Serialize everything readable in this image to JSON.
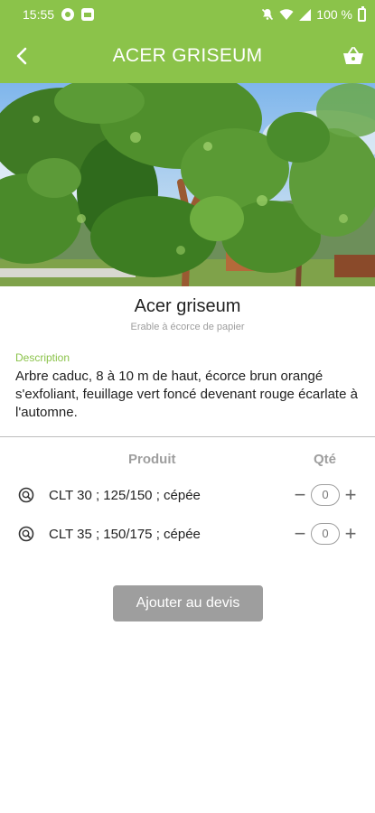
{
  "status_bar": {
    "time": "15:55",
    "battery": "100 %"
  },
  "app_bar": {
    "title": "ACER GRISEUM",
    "back_icon": "chevron-left-icon",
    "cart_icon": "basket-icon"
  },
  "plant": {
    "name": "Acer griseum",
    "common_name": "Erable à écorce de papier",
    "description_label": "Description",
    "description": "Arbre caduc, 8 à 10 m de haut, écorce brun orangé s'exfoliant, feuillage vert foncé devenant rouge écarlate à l'automne."
  },
  "products": {
    "header_product": "Produit",
    "header_qty": "Qté",
    "items": [
      {
        "label": "CLT 30 ; 125/150 ; cépée",
        "qty": "0"
      },
      {
        "label": "CLT 35 ; 150/175 ; cépée",
        "qty": "0"
      }
    ]
  },
  "actions": {
    "add_label": "Ajouter au devis"
  },
  "colors": {
    "accent": "#8bc34a",
    "button_disabled": "#9e9e9e"
  }
}
